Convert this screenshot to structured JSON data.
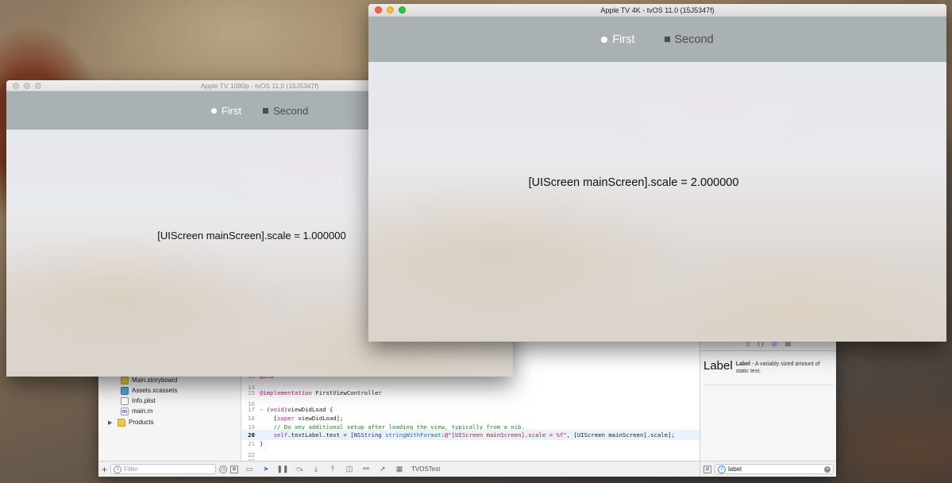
{
  "colors": {
    "close": "#fe5f57",
    "minimize": "#febc2e",
    "zoom": "#28c840",
    "accent": "#2b7cff",
    "tab_bar": "#a9b1b3"
  },
  "sim_1080": {
    "title": "Apple TV 1080p - tvOS 11.0 (15J5347f)",
    "tabs": [
      {
        "label": "First",
        "icon": "circle-icon",
        "selected": true
      },
      {
        "label": "Second",
        "icon": "square-icon",
        "selected": false
      }
    ],
    "label": "[UIScreen mainScreen].scale = 1.000000"
  },
  "sim_4k": {
    "title": "Apple TV 4K - tvOS 11.0 (15J5347f)",
    "tabs": [
      {
        "label": "First",
        "icon": "circle-icon",
        "selected": true
      },
      {
        "label": "Second",
        "icon": "square-icon",
        "selected": false
      }
    ],
    "label": "[UIScreen mainScreen].scale = 2.000000"
  },
  "navigator": {
    "items": [
      {
        "name": "Main.storyboard",
        "icon": "storyboard-icon"
      },
      {
        "name": "Assets.xcassets",
        "icon": "asset-catalog-icon"
      },
      {
        "name": "Info.plist",
        "icon": "plist-icon"
      },
      {
        "name": "main.m",
        "icon": "m-file-icon"
      },
      {
        "name": "Products",
        "icon": "folder-icon"
      }
    ],
    "filter_placeholder": "Filter"
  },
  "editor": {
    "lines": [
      {
        "num": "13",
        "text": "@end"
      },
      {
        "num": "14",
        "text": ""
      },
      {
        "num": "15",
        "text": "@implementation FirstViewController"
      },
      {
        "num": "16",
        "text": ""
      },
      {
        "num": "17",
        "text": "- (void)viewDidLoad {"
      },
      {
        "num": "18",
        "text": "    [super viewDidLoad];"
      },
      {
        "num": "19",
        "text": "    // Do any additional setup after loading the view, typically from a nib."
      },
      {
        "num": "20",
        "text": "    self.textLabel.text = [NSString stringWithFormat:@\"[UIScreen mainScreen].scale = %f\", [UIScreen mainScreen].scale];",
        "current": true
      },
      {
        "num": "21",
        "text": "}"
      },
      {
        "num": "22",
        "text": ""
      },
      {
        "num": "23",
        "text": ""
      }
    ],
    "scheme": "TVOSTest"
  },
  "library": {
    "title": "Label",
    "name": "Label",
    "description": " - A variably sized amount of static text.",
    "search_value": "label"
  }
}
